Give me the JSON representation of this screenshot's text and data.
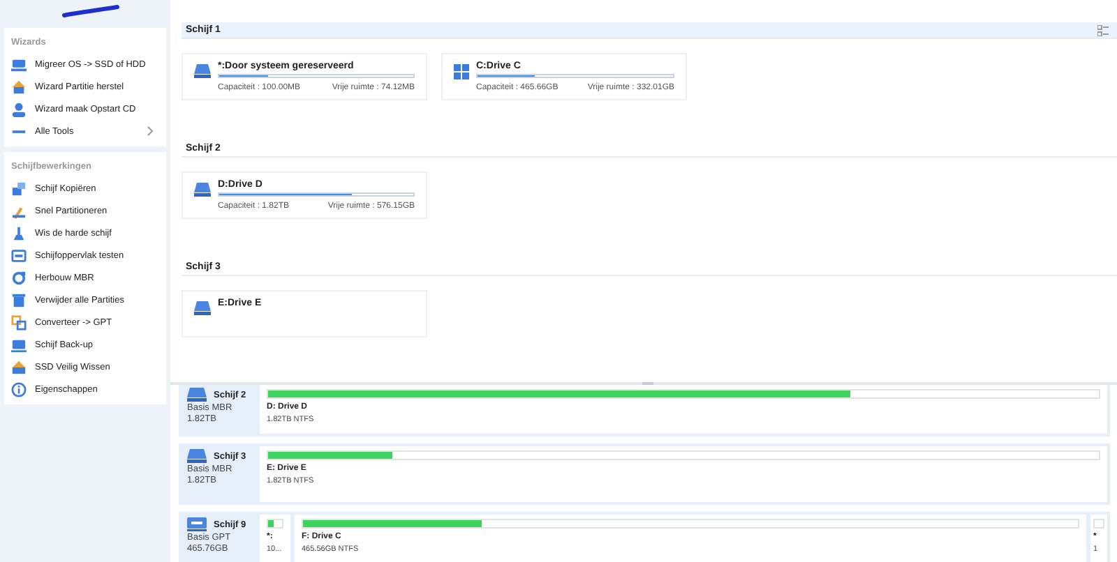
{
  "sidebar": {
    "sections": [
      {
        "title": "Wizards",
        "items": [
          {
            "label": "Migreer OS -> SSD of HDD",
            "chevron": false
          },
          {
            "label": "Wizard Partitie herstel",
            "chevron": false
          },
          {
            "label": "Wizard maak Opstart CD",
            "chevron": false
          },
          {
            "label": "Alle Tools",
            "chevron": true
          }
        ]
      },
      {
        "title": "Schijfbewerkingen",
        "items": [
          {
            "label": "Schijf Kopiëren",
            "chevron": false
          },
          {
            "label": "Snel Partitioneren",
            "chevron": false
          },
          {
            "label": "Wis de harde schijf",
            "chevron": false
          },
          {
            "label": "Schijfoppervlak testen",
            "chevron": false
          },
          {
            "label": "Herbouw MBR",
            "chevron": false
          },
          {
            "label": "Verwijder alle Partities",
            "chevron": false
          },
          {
            "label": "Converteer -> GPT",
            "chevron": false
          },
          {
            "label": "Schijf Back-up",
            "chevron": false
          },
          {
            "label": "SSD Veilig Wissen",
            "chevron": false
          },
          {
            "label": "Eigenschappen",
            "chevron": false
          }
        ]
      }
    ]
  },
  "disks": [
    {
      "title": "Schijf 1",
      "partitions": [
        {
          "kind": "drive",
          "name": "*:Door systeem gereserveerd",
          "level": 0.25,
          "capacity": "Capaciteit : 100.00MB",
          "free": "Vrije ruimte : 74.12MB"
        },
        {
          "kind": "windows",
          "name": "C:Drive C",
          "level": 0.29,
          "capacity": "Capaciteit : 465.66GB",
          "free": "Vrije ruimte : 332.01GB"
        }
      ]
    },
    {
      "title": "Schijf 2",
      "partitions": [
        {
          "kind": "drive",
          "name": "D:Drive D",
          "level": 0.68,
          "capacity": "Capaciteit : 1.82TB",
          "free": "Vrije ruimte : 576.15GB"
        }
      ]
    },
    {
      "title": "Schijf 3",
      "partitions": [
        {
          "kind": "drive",
          "name": "E:Drive E"
        }
      ]
    }
  ],
  "disk_map": [
    {
      "name": "Schijf 2",
      "type": "Basis MBR",
      "size": "1.82TB",
      "usb": false,
      "partitions": [
        {
          "name": "D: Drive D",
          "info": "1.82TB NTFS",
          "level": 0.7,
          "kind": "wide"
        }
      ]
    },
    {
      "name": "Schijf 3",
      "type": "Basis MBR",
      "size": "1.82TB",
      "usb": false,
      "partitions": [
        {
          "name": "E: Drive E",
          "info": "1.82TB NTFS",
          "level": 0.15,
          "kind": "wide"
        }
      ]
    },
    {
      "name": "Schijf 9",
      "type": "Basis GPT",
      "size": "465.76GB",
      "usb": true,
      "partitions": [
        {
          "name": "*:",
          "info": "10...",
          "level": 0.35,
          "kind": "small"
        },
        {
          "name": "F: Drive C",
          "info": "465.56GB NTFS",
          "level": 0.23,
          "kind": "wide"
        },
        {
          "name": "*",
          "info": "1",
          "kind": "tiny"
        }
      ]
    }
  ]
}
